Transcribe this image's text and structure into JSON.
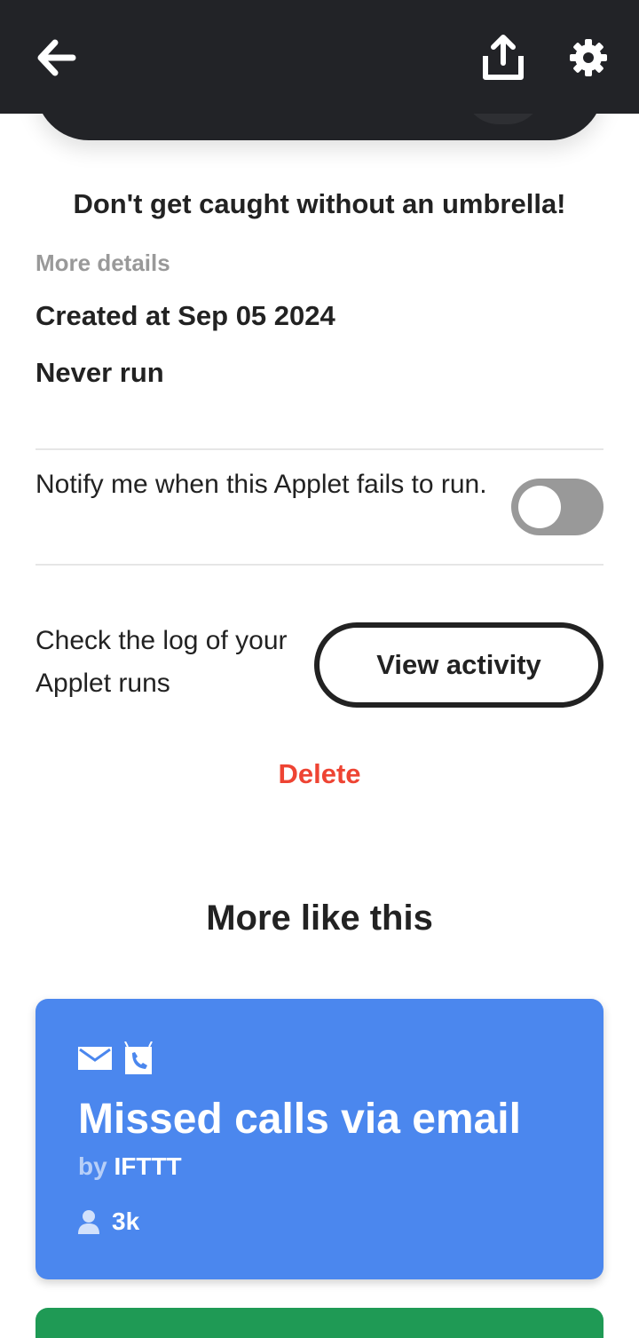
{
  "header": {
    "back_icon": "arrow-left-icon",
    "share_icon": "share-upload-icon",
    "settings_icon": "gear-icon",
    "background": "#222327"
  },
  "applet": {
    "tagline": "Don't get caught without an umbrella!",
    "more_details_label": "More details",
    "created_at": "Created at Sep 05 2024",
    "run_status": "Never run"
  },
  "notify": {
    "text": "Notify me when this Applet fails to run.",
    "toggle_on": false
  },
  "activity": {
    "text": "Check the log of your Applet runs",
    "button_label": "View activity"
  },
  "delete_label": "Delete",
  "more_like_this": {
    "title": "More like this",
    "cards": [
      {
        "icons": [
          "email-icon",
          "phone-call-icon"
        ],
        "title": "Missed calls via email",
        "by": "by",
        "author": "IFTTT",
        "user_icon": "user-icon",
        "users": "3k",
        "color": "#4b87ee"
      },
      {
        "color": "#1f9a55"
      }
    ]
  },
  "colors": {
    "danger": "#ee4433",
    "muted": "#999999",
    "text": "#222222"
  }
}
